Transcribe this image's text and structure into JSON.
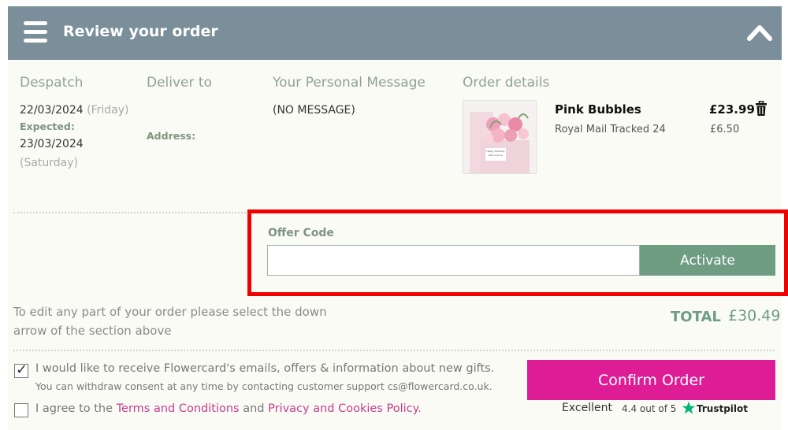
{
  "header": {
    "title": "Review your order"
  },
  "columns": {
    "despatch": "Despatch",
    "deliver_to": "Deliver to",
    "message": "Your Personal Message",
    "order_details": "Order details"
  },
  "despatch": {
    "date": "22/03/2024",
    "day": "(Friday)",
    "expected_label": "Expected:",
    "expected_date": "23/03/2024",
    "expected_day": "(Saturday)"
  },
  "deliver": {
    "address_label": "Address:"
  },
  "message": {
    "text": "(NO MESSAGE)"
  },
  "order": {
    "product_name": "Pink Bubbles",
    "price": "£23.99",
    "shipping_method": "Royal Mail Tracked 24",
    "shipping_price": "£6.50",
    "card_lines": [
      "Happy Birthday",
      "with love xx"
    ]
  },
  "offer": {
    "label": "Offer Code",
    "input_value": "",
    "button_label": "Activate"
  },
  "edit_note": "To edit any part of your order please select the down arrow of the section above",
  "total": {
    "label": "TOTAL",
    "value": "£30.49"
  },
  "consent": {
    "emails_text": "I would like to receive Flowercard's emails, offers & information about new gifts.",
    "emails_sub": "You can withdraw consent at any time by contacting customer support cs@flowercard.co.uk.",
    "emails_checked": true,
    "terms_prefix": "I agree to the ",
    "terms_link": "Terms and Conditions",
    "terms_and": " and ",
    "privacy_link": "Privacy and Cookies Policy",
    "terms_suffix": ".",
    "terms_checked": false
  },
  "confirm": {
    "button_label": "Confirm Order"
  },
  "trustpilot": {
    "rating": "Excellent",
    "score": "4.4 out of 5",
    "brand": "Trustpilot"
  },
  "colors": {
    "header": "#7a8f99",
    "accent_green": "#6e9d82",
    "confirm_pink": "#de1c95",
    "highlight_red": "#f20000"
  }
}
